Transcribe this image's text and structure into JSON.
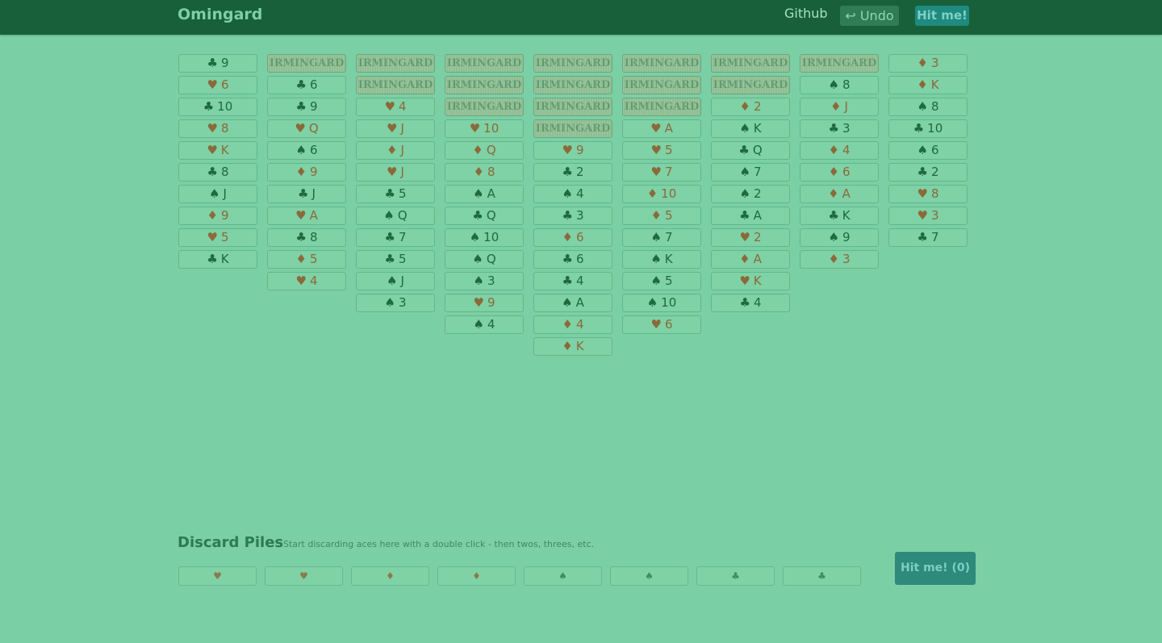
{
  "header": {
    "brand": "Omingard",
    "github_label": "Github",
    "undo_label": "↩ Undo",
    "hit_label": "Hit me!"
  },
  "card_back_text": "IRMINGARD",
  "tableau": [
    {
      "face_down": 0,
      "cards": [
        {
          "suit": "clubs",
          "rank": "9"
        },
        {
          "suit": "hearts",
          "rank": "6"
        },
        {
          "suit": "clubs",
          "rank": "10"
        },
        {
          "suit": "hearts",
          "rank": "8"
        },
        {
          "suit": "hearts",
          "rank": "K"
        },
        {
          "suit": "clubs",
          "rank": "8"
        },
        {
          "suit": "spades",
          "rank": "J"
        },
        {
          "suit": "diamonds",
          "rank": "9"
        },
        {
          "suit": "hearts",
          "rank": "5"
        },
        {
          "suit": "clubs",
          "rank": "K"
        }
      ]
    },
    {
      "face_down": 1,
      "cards": [
        {
          "suit": "clubs",
          "rank": "6"
        },
        {
          "suit": "clubs",
          "rank": "9"
        },
        {
          "suit": "hearts",
          "rank": "Q"
        },
        {
          "suit": "spades",
          "rank": "6"
        },
        {
          "suit": "diamonds",
          "rank": "9"
        },
        {
          "suit": "clubs",
          "rank": "J"
        },
        {
          "suit": "hearts",
          "rank": "A"
        },
        {
          "suit": "clubs",
          "rank": "8"
        },
        {
          "suit": "diamonds",
          "rank": "5"
        },
        {
          "suit": "hearts",
          "rank": "4"
        }
      ]
    },
    {
      "face_down": 2,
      "cards": [
        {
          "suit": "hearts",
          "rank": "4"
        },
        {
          "suit": "hearts",
          "rank": "J"
        },
        {
          "suit": "diamonds",
          "rank": "J"
        },
        {
          "suit": "hearts",
          "rank": "J"
        },
        {
          "suit": "clubs",
          "rank": "5"
        },
        {
          "suit": "spades",
          "rank": "Q"
        },
        {
          "suit": "clubs",
          "rank": "7"
        },
        {
          "suit": "clubs",
          "rank": "5"
        },
        {
          "suit": "spades",
          "rank": "J"
        },
        {
          "suit": "spades",
          "rank": "3"
        }
      ]
    },
    {
      "face_down": 3,
      "cards": [
        {
          "suit": "hearts",
          "rank": "10"
        },
        {
          "suit": "diamonds",
          "rank": "Q"
        },
        {
          "suit": "diamonds",
          "rank": "8"
        },
        {
          "suit": "spades",
          "rank": "A"
        },
        {
          "suit": "clubs",
          "rank": "Q"
        },
        {
          "suit": "spades",
          "rank": "10"
        },
        {
          "suit": "spades",
          "rank": "Q"
        },
        {
          "suit": "spades",
          "rank": "3"
        },
        {
          "suit": "hearts",
          "rank": "9"
        },
        {
          "suit": "spades",
          "rank": "4"
        }
      ]
    },
    {
      "face_down": 4,
      "cards": [
        {
          "suit": "hearts",
          "rank": "9"
        },
        {
          "suit": "clubs",
          "rank": "2"
        },
        {
          "suit": "spades",
          "rank": "4"
        },
        {
          "suit": "clubs",
          "rank": "3"
        },
        {
          "suit": "diamonds",
          "rank": "6"
        },
        {
          "suit": "clubs",
          "rank": "6"
        },
        {
          "suit": "clubs",
          "rank": "4"
        },
        {
          "suit": "spades",
          "rank": "A"
        },
        {
          "suit": "diamonds",
          "rank": "4"
        },
        {
          "suit": "diamonds",
          "rank": "K"
        }
      ]
    },
    {
      "face_down": 3,
      "cards": [
        {
          "suit": "hearts",
          "rank": "A"
        },
        {
          "suit": "hearts",
          "rank": "5"
        },
        {
          "suit": "hearts",
          "rank": "7"
        },
        {
          "suit": "diamonds",
          "rank": "10"
        },
        {
          "suit": "diamonds",
          "rank": "5"
        },
        {
          "suit": "spades",
          "rank": "7"
        },
        {
          "suit": "spades",
          "rank": "K"
        },
        {
          "suit": "spades",
          "rank": "5"
        },
        {
          "suit": "spades",
          "rank": "10"
        },
        {
          "suit": "hearts",
          "rank": "6"
        }
      ]
    },
    {
      "face_down": 2,
      "cards": [
        {
          "suit": "diamonds",
          "rank": "2"
        },
        {
          "suit": "spades",
          "rank": "K"
        },
        {
          "suit": "clubs",
          "rank": "Q"
        },
        {
          "suit": "spades",
          "rank": "7"
        },
        {
          "suit": "spades",
          "rank": "2"
        },
        {
          "suit": "clubs",
          "rank": "A"
        },
        {
          "suit": "hearts",
          "rank": "2"
        },
        {
          "suit": "diamonds",
          "rank": "A"
        },
        {
          "suit": "hearts",
          "rank": "K"
        },
        {
          "suit": "clubs",
          "rank": "4"
        }
      ]
    },
    {
      "face_down": 1,
      "cards": [
        {
          "suit": "spades",
          "rank": "8"
        },
        {
          "suit": "diamonds",
          "rank": "J"
        },
        {
          "suit": "clubs",
          "rank": "3"
        },
        {
          "suit": "diamonds",
          "rank": "4"
        },
        {
          "suit": "diamonds",
          "rank": "6"
        },
        {
          "suit": "diamonds",
          "rank": "A"
        },
        {
          "suit": "clubs",
          "rank": "K"
        },
        {
          "suit": "spades",
          "rank": "9"
        },
        {
          "suit": "diamonds",
          "rank": "3"
        }
      ]
    },
    {
      "face_down": 0,
      "cards": [
        {
          "suit": "diamonds",
          "rank": "3"
        },
        {
          "suit": "diamonds",
          "rank": "K"
        },
        {
          "suit": "spades",
          "rank": "8"
        },
        {
          "suit": "clubs",
          "rank": "10"
        },
        {
          "suit": "spades",
          "rank": "6"
        },
        {
          "suit": "clubs",
          "rank": "2"
        },
        {
          "suit": "hearts",
          "rank": "8"
        },
        {
          "suit": "hearts",
          "rank": "3"
        },
        {
          "suit": "clubs",
          "rank": "7"
        }
      ]
    }
  ],
  "discard": {
    "title": "Discard Piles",
    "subtitle": "Start discarding aces here with a double click - then twos, threes, etc.",
    "piles": [
      {
        "suit": "hearts"
      },
      {
        "suit": "hearts"
      },
      {
        "suit": "diamonds"
      },
      {
        "suit": "diamonds"
      },
      {
        "suit": "spades"
      },
      {
        "suit": "spades"
      },
      {
        "suit": "clubs"
      },
      {
        "suit": "clubs"
      }
    ]
  },
  "hit_big_label": "Hit me! (0)",
  "suit_symbols": {
    "hearts": "♥",
    "diamonds": "♦",
    "spades": "♠",
    "clubs": "♣"
  },
  "colors": {
    "background": "#7bcfa4",
    "navbar": "#17603a",
    "black_suit": "#1f6a40",
    "red_suit": "#8a6a3a",
    "hit_button": "#2e8a7a"
  }
}
